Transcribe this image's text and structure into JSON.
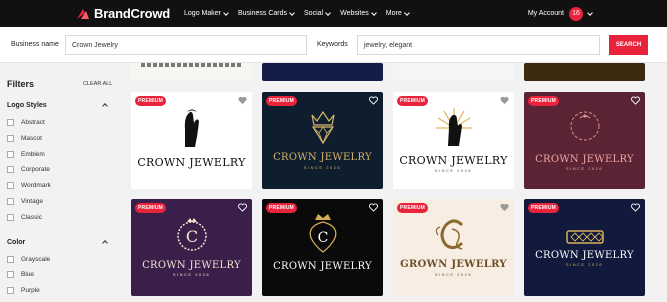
{
  "topbar": {
    "brand": "BrandCrowd",
    "nav": [
      "Logo Maker",
      "Business Cards",
      "Social",
      "Websites",
      "More"
    ],
    "account_label": "My Account",
    "account_count": "16"
  },
  "search": {
    "business_label": "Business name",
    "business_value": "Crown Jewelry",
    "keywords_label": "Keywords",
    "keywords_value": "jewelry, elegant",
    "button": "SEARCH"
  },
  "sidebar": {
    "title": "Filters",
    "clear_all": "CLEAR ALL",
    "logo_styles_title": "Logo Styles",
    "logo_styles": [
      "Abstract",
      "Mascot",
      "Emblem",
      "Corporate",
      "Wordmark",
      "Vintage",
      "Classic"
    ],
    "color_title": "Color",
    "colors": [
      "Grayscale",
      "Blue",
      "Purple"
    ]
  },
  "badge": "PREMIUM",
  "cards": [
    {
      "name": "CROWN JEWELRY",
      "sub": ""
    },
    {
      "name": "CROWN JEWELRY",
      "sub": "SINCE 2026"
    },
    {
      "name": "CROWN JEWELRY",
      "sub": "SINCE 2026"
    },
    {
      "name": "CROWN JEWELRY",
      "sub": "SINCE 2026"
    },
    {
      "name": "CROWN JEWELRY",
      "sub": "SINCE 2026"
    },
    {
      "name": "CROWN JEWELRY",
      "sub": ""
    },
    {
      "name": "GROWN JEWELRY",
      "sub": "SINCE 2026"
    },
    {
      "name": "CROWN JEWELRY",
      "sub": "SINCE 2026"
    }
  ],
  "colors": {
    "accent": "#e8233b",
    "topbar": "#111111"
  }
}
